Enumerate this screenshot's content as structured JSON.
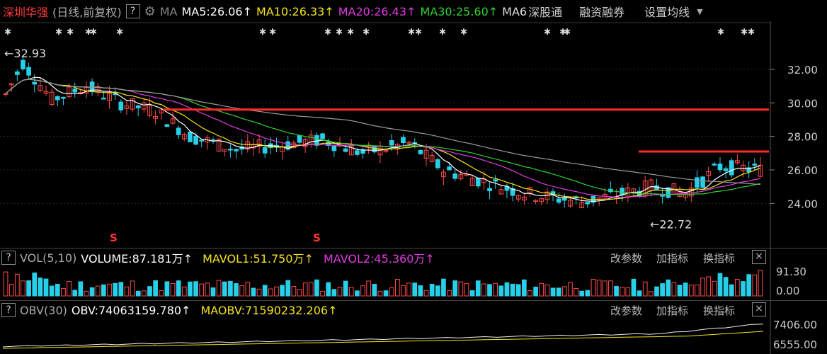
{
  "header": {
    "stock_name": "深圳华强",
    "period": "(日线,前复权)",
    "help": "?",
    "ma_label": "MA",
    "ma5": "MA5:26.06",
    "ma10": "MA10:26.33",
    "ma20": "MA20:26.43",
    "ma30": "MA30:25.60",
    "ma6": "MA6",
    "arrow": "↑",
    "menu1": "深股通",
    "menu2": "融资融券",
    "menu3": "设置均线"
  },
  "vol_panel": {
    "label": "VOL(5,10)",
    "volume": "VOLUME:87.181万",
    "mavol1": "MAVOL1:51.750万",
    "mavol2": "MAVOL2:45.360万",
    "arrow": "↑",
    "btn_modify": "改参数",
    "btn_add": "加指标",
    "btn_switch": "换指标",
    "close": "×",
    "axis_top": "91.30",
    "axis_bottom": "0.00"
  },
  "obv_panel": {
    "label": "OBV(30)",
    "obv": "OBV:74063159.780",
    "maobv": "MAOBV:71590232.206",
    "arrow": "↑",
    "btn_modify": "改参数",
    "btn_add": "加指标",
    "btn_switch": "换指标",
    "close": "×",
    "axis_top": "7406.00",
    "axis_bottom": "6555.00"
  },
  "chart_data": {
    "type": "candlestick",
    "yticks": [
      "32.00",
      "30.00",
      "28.00",
      "26.00",
      "24.00"
    ],
    "ytick_values": [
      32,
      30,
      28,
      26,
      24
    ],
    "ylim": [
      22.2,
      33.6
    ],
    "high_label": "32.93",
    "low_label": "22.72",
    "high_value": 32.93,
    "low_value": 22.72,
    "s_marker": "S",
    "resistance_levels": [
      29.6,
      27.1
    ],
    "colors": {
      "up": "#ff4a4a",
      "down": "#27d0e8",
      "ma5": "#ffffff",
      "ma10": "#f5e21b",
      "ma20": "#e03ce0",
      "ma30": "#2fd12f",
      "ma60": "#9a9a9a",
      "level": "#ff2a2a"
    }
  }
}
